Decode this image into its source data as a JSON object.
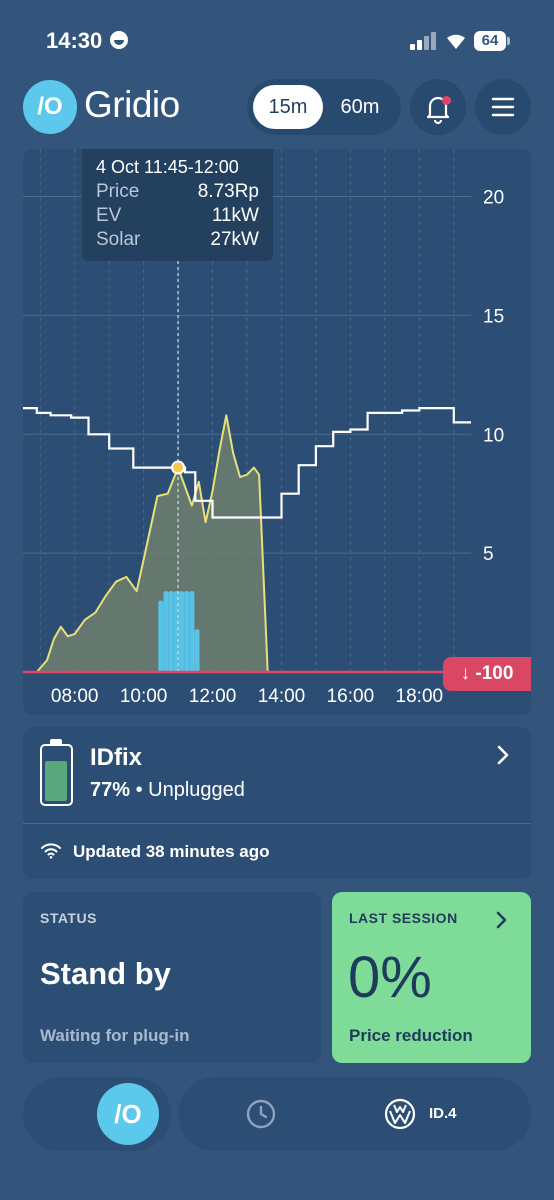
{
  "status_bar": {
    "time": "14:30",
    "battery": "64"
  },
  "header": {
    "logo_mark": "/O",
    "app_name": "Gridio",
    "interval_options": [
      "15m",
      "60m"
    ],
    "interval_selected": "15m",
    "bell_icon": "bell-icon",
    "menu_icon": "menu-icon"
  },
  "chart": {
    "tooltip": {
      "title": "4 Oct 11:45-12:00",
      "rows": [
        {
          "label": "Price",
          "value": "8.73Rp"
        },
        {
          "label": "EV",
          "value": "11kW"
        },
        {
          "label": "Solar",
          "value": "27kW"
        }
      ]
    },
    "min_badge": "↓ -100",
    "colors": {
      "price_line": "#ffffff",
      "solar": "#e9e07a",
      "ev_bars": "#58c3e8",
      "baseline": "#e24567"
    }
  },
  "chart_data": {
    "type": "line",
    "y_axis_ticks": [
      "5",
      "10",
      "15",
      "20"
    ],
    "x_axis_ticks": [
      "08:00",
      "10:00",
      "12:00",
      "14:00",
      "16:00",
      "18:00"
    ],
    "ylim": [
      0,
      22
    ],
    "x_hours": [
      6.5,
      19.5
    ],
    "grid": true,
    "price_series": {
      "x": [
        6.5,
        6.9,
        7.3,
        7.9,
        8.4,
        9.0,
        9.7,
        10.5,
        11.2,
        11.5,
        12.0,
        12.5,
        13.0,
        13.5,
        14.0,
        14.5,
        15.0,
        15.5,
        16.0,
        16.5,
        17.0,
        17.5,
        18.0,
        18.5,
        19.0,
        19.5
      ],
      "y": [
        11.1,
        10.9,
        10.8,
        10.7,
        10.0,
        9.4,
        8.6,
        8.6,
        8.4,
        7.2,
        6.5,
        6.5,
        6.5,
        6.5,
        7.5,
        8.7,
        9.5,
        10.1,
        10.2,
        10.9,
        10.9,
        11.0,
        11.1,
        11.1,
        10.5,
        10.5
      ]
    },
    "solar_series": {
      "x": [
        6.5,
        6.9,
        7.2,
        7.4,
        7.6,
        7.8,
        8.0,
        8.3,
        8.6,
        8.9,
        9.2,
        9.5,
        9.8,
        10.1,
        10.4,
        10.7,
        11.0,
        11.2,
        11.4,
        11.6,
        11.8,
        12.0,
        12.2,
        12.4,
        12.6,
        12.8,
        13.0,
        13.2,
        13.35,
        13.6
      ],
      "y": [
        0,
        0,
        0.5,
        1.4,
        1.9,
        1.5,
        1.6,
        2.2,
        2.5,
        3.2,
        3.8,
        4.0,
        3.4,
        5.4,
        7.4,
        7.5,
        8.6,
        7.8,
        7.0,
        8.0,
        6.3,
        7.6,
        9.3,
        10.8,
        9.2,
        8.2,
        8.3,
        8.6,
        8.3,
        0
      ]
    },
    "ev_series": {
      "x": [
        10.5,
        10.65,
        10.8,
        10.95,
        11.1,
        11.25,
        11.4,
        11.55
      ],
      "y": [
        3.0,
        3.4,
        3.4,
        3.4,
        3.4,
        3.4,
        3.4,
        1.8
      ]
    },
    "selected_x": 11.0,
    "selected_y": 8.6
  },
  "vehicle": {
    "name": "IDfix",
    "battery_level": 0.77,
    "percent": "77%",
    "state": "• Unplugged",
    "updated": "Updated 38 minutes ago"
  },
  "status_card": {
    "label": "STATUS",
    "value": "Stand by",
    "sub": "Waiting for plug-in"
  },
  "session_card": {
    "label": "LAST SESSION",
    "value": "0%",
    "sub": "Price reduction"
  },
  "bottom_nav": {
    "home_mark": "/O",
    "clock_icon": "clock-icon",
    "vw_icon": "vw-logo-icon",
    "car_model": "ID.4"
  }
}
